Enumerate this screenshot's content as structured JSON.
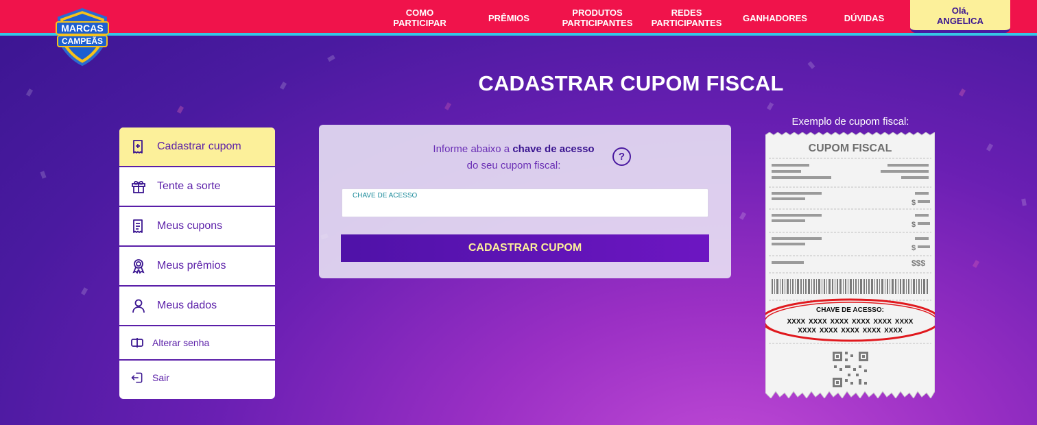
{
  "header": {
    "logo_text_line1": "MARCAS",
    "logo_text_line2": "CAMPEÃS",
    "nav": [
      {
        "label": "COMO\nPARTICIPAR"
      },
      {
        "label": "PRÊMIOS"
      },
      {
        "label": "PRODUTOS\nPARTICIPANTES"
      },
      {
        "label": "REDES\nPARTICIPANTES"
      },
      {
        "label": "GANHADORES"
      },
      {
        "label": "DÚVIDAS"
      }
    ],
    "user_greeting": "Olá,\nANGELICA"
  },
  "page_title": "CADASTRAR CUPOM FISCAL",
  "sidebar": {
    "items": [
      {
        "label": "Cadastrar cupom",
        "icon": "receipt-add-icon",
        "active": true
      },
      {
        "label": "Tente a sorte",
        "icon": "gift-icon"
      },
      {
        "label": "Meus cupons",
        "icon": "receipt-list-icon"
      },
      {
        "label": "Meus prêmios",
        "icon": "award-icon"
      },
      {
        "label": "Meus dados",
        "icon": "user-icon"
      },
      {
        "label": "Alterar senha",
        "icon": "password-icon"
      },
      {
        "label": "Sair",
        "icon": "logout-icon"
      }
    ]
  },
  "form": {
    "instruction_prefix": "Informe abaixo a ",
    "instruction_bold": "chave de acesso",
    "instruction_suffix": "do seu cupom fiscal:",
    "help": "?",
    "input_label": "CHAVE DE ACESSO",
    "input_value": "",
    "submit_label": "CADASTRAR CUPOM"
  },
  "receipt": {
    "caption": "Exemplo de cupom fiscal:",
    "title": "CUPOM FISCAL",
    "subtotals": [
      "$",
      "$",
      "$"
    ],
    "total": "$$$",
    "chave_label": "CHAVE DE ACESSO:",
    "chave_line1": "XXXX XXXX XXXX XXXX XXXX XXXX",
    "chave_line2": "XXXX XXXX XXXX XXXX XXXX"
  },
  "colors": {
    "header_red": "#f0134b",
    "accent_cyan": "#35c7e6",
    "purple": "#5a1ea8",
    "yellow": "#fcf09a",
    "highlight_red": "#e0191e"
  }
}
